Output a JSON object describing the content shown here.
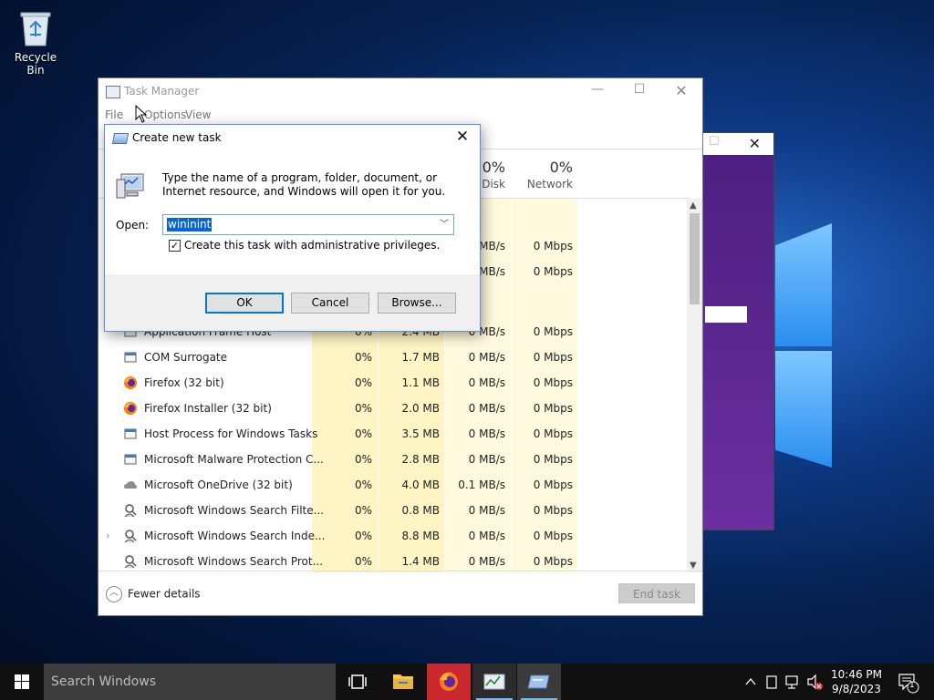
{
  "desktop": {
    "recycle_bin_label": "Recycle Bin"
  },
  "task_manager": {
    "title": "Task Manager",
    "menu": {
      "file": "File",
      "options": "Options",
      "view": "View"
    },
    "columns": {
      "disk_pct": "0%",
      "disk_label": "Disk",
      "network_pct": "0%",
      "network_label": "Network"
    },
    "partial_rows": [
      {
        "disk": "MB/s",
        "network": "0 Mbps"
      },
      {
        "disk": "MB/s",
        "network": "0 Mbps"
      }
    ],
    "rows": [
      {
        "name": "Application Frame Host",
        "cpu": "0%",
        "memory": "2.4 MB",
        "disk": "0 MB/s",
        "network": "0 Mbps",
        "icon": "app-frame-icon"
      },
      {
        "name": "COM Surrogate",
        "cpu": "0%",
        "memory": "1.7 MB",
        "disk": "0 MB/s",
        "network": "0 Mbps",
        "icon": "window-icon"
      },
      {
        "name": "Firefox (32 bit)",
        "cpu": "0%",
        "memory": "1.1 MB",
        "disk": "0 MB/s",
        "network": "0 Mbps",
        "icon": "firefox-icon"
      },
      {
        "name": "Firefox Installer (32 bit)",
        "cpu": "0%",
        "memory": "2.0 MB",
        "disk": "0 MB/s",
        "network": "0 Mbps",
        "icon": "firefox-icon"
      },
      {
        "name": "Host Process for Windows Tasks",
        "cpu": "0%",
        "memory": "3.5 MB",
        "disk": "0 MB/s",
        "network": "0 Mbps",
        "icon": "window-icon"
      },
      {
        "name": "Microsoft Malware Protection C...",
        "cpu": "0%",
        "memory": "2.8 MB",
        "disk": "0 MB/s",
        "network": "0 Mbps",
        "icon": "window-icon"
      },
      {
        "name": "Microsoft OneDrive (32 bit)",
        "cpu": "0%",
        "memory": "4.0 MB",
        "disk": "0.1 MB/s",
        "network": "0 Mbps",
        "icon": "cloud-icon"
      },
      {
        "name": "Microsoft Windows Search Filte...",
        "cpu": "0%",
        "memory": "0.8 MB",
        "disk": "0 MB/s",
        "network": "0 Mbps",
        "icon": "search-person-icon"
      },
      {
        "name": "Microsoft Windows Search Inde...",
        "cpu": "0%",
        "memory": "8.8 MB",
        "disk": "0 MB/s",
        "network": "0 Mbps",
        "icon": "search-person-icon",
        "expandable": true
      },
      {
        "name": "Microsoft Windows Search Prot...",
        "cpu": "0%",
        "memory": "1.4 MB",
        "disk": "0 MB/s",
        "network": "0 Mbps",
        "icon": "search-person-icon"
      }
    ],
    "fewer_details": "Fewer details",
    "end_task": "End task"
  },
  "dialog": {
    "title": "Create new task",
    "description": "Type the name of a program, folder, document, or Internet resource, and Windows will open it for you.",
    "open_label": "Open:",
    "open_value": "wininint",
    "admin_checkbox_label": "Create this task with administrative privileges.",
    "admin_checked": true,
    "ok": "OK",
    "cancel": "Cancel",
    "browse": "Browse..."
  },
  "taskbar": {
    "search_placeholder": "Search Windows",
    "time": "10:46 PM",
    "date": "9/8/2023",
    "notification_count": "1",
    "accent_color": "#c8282e"
  }
}
